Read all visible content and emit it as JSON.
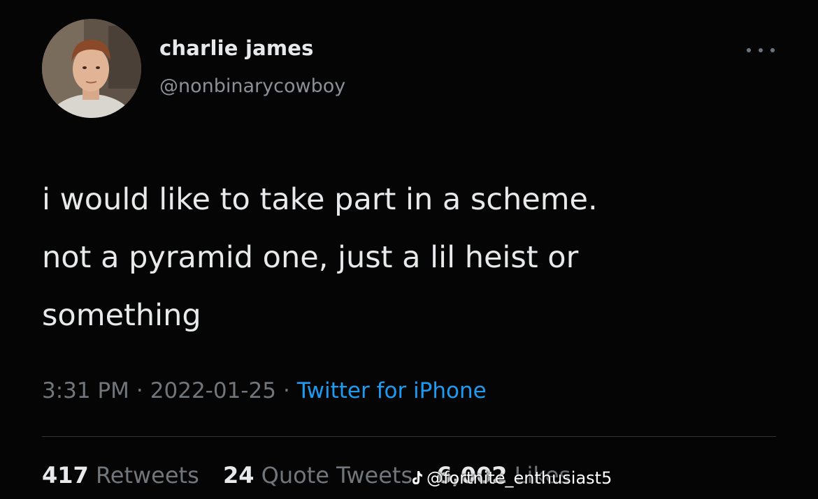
{
  "author": {
    "display_name": "charlie james",
    "handle": "@nonbinarycowboy",
    "avatar_icon": "profile-photo"
  },
  "tweet": {
    "text": "i would like to take part in a scheme.\nnot a pyramid one, just a lil heist or\nsomething",
    "time": "3:31 PM",
    "date": "2022-01-25",
    "separator": "·",
    "source": "Twitter for iPhone"
  },
  "stats": {
    "retweets_count": "417",
    "retweets_label": "Retweets",
    "quotes_count": "24",
    "quotes_label": "Quote Tweets",
    "likes_count": "6,002",
    "likes_label": "Likes"
  },
  "watermark": {
    "icon": "tiktok-icon",
    "text": "@fortnite_enthusiast5"
  },
  "colors": {
    "background": "#050505",
    "primary_text": "#e7e9ea",
    "secondary_text": "#71767b",
    "link": "#1d9bf0"
  }
}
